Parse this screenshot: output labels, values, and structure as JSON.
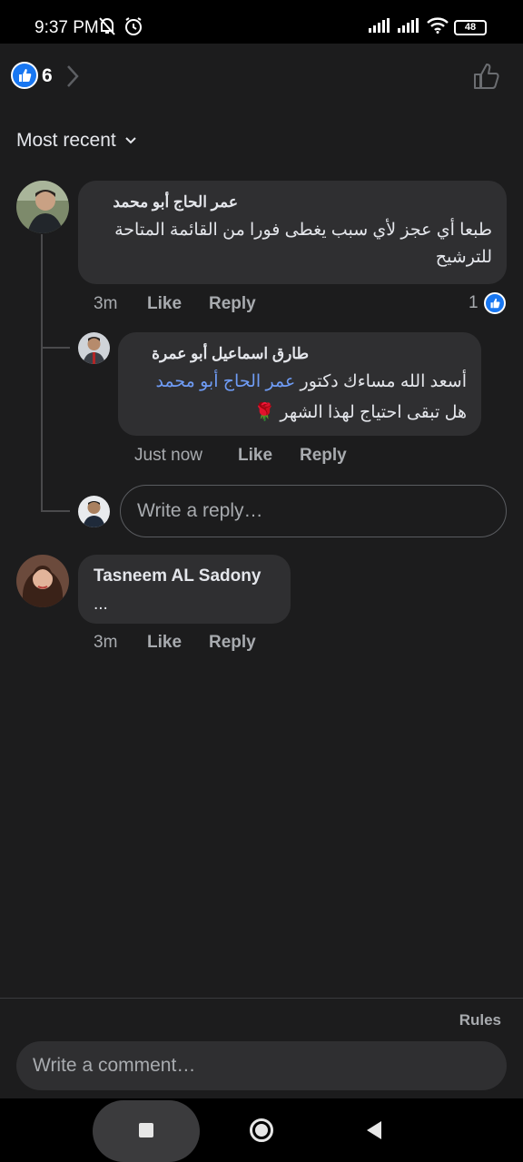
{
  "status_bar": {
    "time": "9:37 PM",
    "battery": "48"
  },
  "header": {
    "like_count": "6"
  },
  "sort": {
    "label": "Most recent"
  },
  "comments": [
    {
      "author": "عمر الحاج أبو محمد",
      "text": "طبعا أي عجز لأي سبب يغطى فورا من القائمة المتاحة للترشيح",
      "time": "3m",
      "like_label": "Like",
      "reply_label": "Reply",
      "reaction_count": "1",
      "replies": [
        {
          "author": "طارق اسماعيل أبو عمرة",
          "mention": "عمر الحاج أبو محمد",
          "text_line1": "أسعد الله مساءك دكتور",
          "text_line2": "هل تبقى احتياج لهذا الشهر 🌹",
          "time": "Just now",
          "like_label": "Like",
          "reply_label": "Reply"
        }
      ],
      "reply_placeholder": "Write a reply…"
    },
    {
      "author": "Tasneem AL Sadony",
      "text": "...",
      "time": "3m",
      "like_label": "Like",
      "reply_label": "Reply"
    }
  ],
  "footer": {
    "rules_label": "Rules",
    "comment_placeholder": "Write a comment…"
  },
  "colors": {
    "background": "#1c1c1d",
    "bubble": "#2f2f31",
    "accent": "#1877f2",
    "mention": "#6f9cf5"
  }
}
